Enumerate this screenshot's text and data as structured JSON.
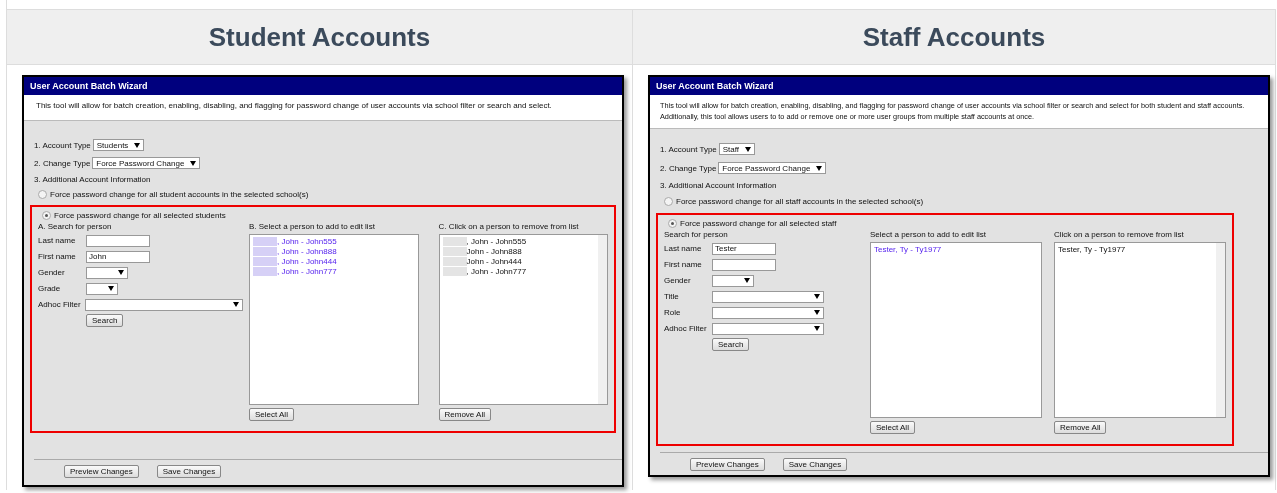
{
  "panels": [
    {
      "heading": "Student Accounts",
      "wizard": {
        "title": "User Account Batch Wizard",
        "description": [
          "This tool will allow for batch creation, enabling, disabling, and flagging for password change of user accounts via school filter or search and select."
        ],
        "account_type": {
          "label": "1. Account Type",
          "value": "Students"
        },
        "change_type": {
          "label": "2. Change Type",
          "value": "Force Password Change"
        },
        "additional_label": "3. Additional Account Information",
        "options": [
          {
            "label": "Force password change for all student accounts in the selected school(s)",
            "selected": false
          },
          {
            "label": "Force password change for all selected students",
            "selected": true
          }
        ],
        "search": {
          "heading": "A. Search for person",
          "fields": [
            {
              "kind": "text",
              "label": "Last name"
            },
            {
              "kind": "text",
              "label": "First name",
              "value": "John"
            },
            {
              "kind": "short-select",
              "label": "Gender"
            },
            {
              "kind": "tiny-select",
              "label": "Grade"
            },
            {
              "kind": "long-select",
              "label": "Adhoc Filter"
            }
          ],
          "button": "Search"
        },
        "add_list": {
          "heading": "B. Select a person to add to edit list",
          "items": [
            {
              "text": ", John - John555",
              "redacted": true
            },
            {
              "text": ", John - John888",
              "redacted": true
            },
            {
              "text": ", John -  John444",
              "redacted": true
            },
            {
              "text": ", John - John777",
              "redacted": true
            }
          ],
          "button": "Select All"
        },
        "remove_list": {
          "heading": "C. Click on a person to remove from list",
          "items": [
            {
              "text": ", John -  John555",
              "redacted": true
            },
            {
              "text": "John - John888",
              "redacted": true
            },
            {
              "text": "John - John444",
              "redacted": true
            },
            {
              "text": ", John - John777",
              "redacted": true
            }
          ],
          "button": "Remove All"
        },
        "buttons": [
          "Preview Changes",
          "Save Changes"
        ]
      }
    },
    {
      "heading": "Staff Accounts",
      "wizard": {
        "title": "User Account Batch Wizard",
        "description": [
          "This tool will allow for batch creation, enabling, disabling, and flagging for password change of user accounts via school filter or search and select for both student and staff accounts.",
          "Additionally, this tool allows users to to add or remove one or more user groups from multiple staff accounts at once."
        ],
        "account_type": {
          "label": "1. Account Type",
          "value": "Staff"
        },
        "change_type": {
          "label": "2. Change Type",
          "value": "Force Password Change"
        },
        "additional_label": "3. Additional Account Information",
        "options": [
          {
            "label": "Force password change for all staff accounts in the selected school(s)",
            "selected": false
          },
          {
            "label": "Force password change for all selected staff",
            "selected": true
          }
        ],
        "search": {
          "heading": "Search for person",
          "fields": [
            {
              "kind": "text",
              "label": "Last name",
              "value": "Tester"
            },
            {
              "kind": "text",
              "label": "First name"
            },
            {
              "kind": "short-select",
              "label": "Gender"
            },
            {
              "kind": "long-select",
              "label": "Title"
            },
            {
              "kind": "long-select",
              "label": "Role"
            },
            {
              "kind": "long-select",
              "label": "Adhoc Filter"
            }
          ],
          "button": "Search"
        },
        "add_list": {
          "heading": "Select a person to add to edit list",
          "items": [
            {
              "text": "Tester, Ty - Ty1977",
              "redacted": false
            }
          ],
          "button": "Select All"
        },
        "remove_list": {
          "heading": "Click on a person to remove from list",
          "items": [
            {
              "text": "Tester, Ty - Ty1977",
              "redacted": false
            }
          ],
          "button": "Remove All"
        },
        "buttons": [
          "Preview Changes",
          "Save Changes"
        ]
      }
    }
  ]
}
